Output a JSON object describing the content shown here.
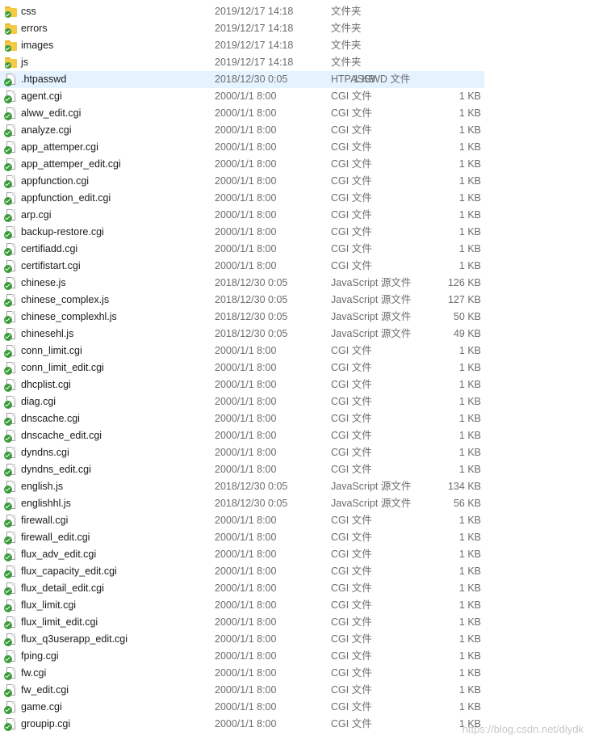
{
  "files": [
    {
      "name": "css",
      "date": "2019/12/17 14:18",
      "type": "文件夹",
      "size": "",
      "kind": "folder"
    },
    {
      "name": "errors",
      "date": "2019/12/17 14:18",
      "type": "文件夹",
      "size": "",
      "kind": "folder"
    },
    {
      "name": "images",
      "date": "2019/12/17 14:18",
      "type": "文件夹",
      "size": "",
      "kind": "folder"
    },
    {
      "name": "js",
      "date": "2019/12/17 14:18",
      "type": "文件夹",
      "size": "",
      "kind": "folder"
    },
    {
      "name": ".htpasswd",
      "date": "2018/12/30 0:05",
      "type": "HTPASSWD 文件",
      "size": "1 KB",
      "kind": "file",
      "selected": true
    },
    {
      "name": "agent.cgi",
      "date": "2000/1/1 8:00",
      "type": "CGI 文件",
      "size": "1 KB",
      "kind": "file"
    },
    {
      "name": "alww_edit.cgi",
      "date": "2000/1/1 8:00",
      "type": "CGI 文件",
      "size": "1 KB",
      "kind": "file"
    },
    {
      "name": "analyze.cgi",
      "date": "2000/1/1 8:00",
      "type": "CGI 文件",
      "size": "1 KB",
      "kind": "file"
    },
    {
      "name": "app_attemper.cgi",
      "date": "2000/1/1 8:00",
      "type": "CGI 文件",
      "size": "1 KB",
      "kind": "file"
    },
    {
      "name": "app_attemper_edit.cgi",
      "date": "2000/1/1 8:00",
      "type": "CGI 文件",
      "size": "1 KB",
      "kind": "file"
    },
    {
      "name": "appfunction.cgi",
      "date": "2000/1/1 8:00",
      "type": "CGI 文件",
      "size": "1 KB",
      "kind": "file"
    },
    {
      "name": "appfunction_edit.cgi",
      "date": "2000/1/1 8:00",
      "type": "CGI 文件",
      "size": "1 KB",
      "kind": "file"
    },
    {
      "name": "arp.cgi",
      "date": "2000/1/1 8:00",
      "type": "CGI 文件",
      "size": "1 KB",
      "kind": "file"
    },
    {
      "name": "backup-restore.cgi",
      "date": "2000/1/1 8:00",
      "type": "CGI 文件",
      "size": "1 KB",
      "kind": "file"
    },
    {
      "name": "certifiadd.cgi",
      "date": "2000/1/1 8:00",
      "type": "CGI 文件",
      "size": "1 KB",
      "kind": "file"
    },
    {
      "name": "certifistart.cgi",
      "date": "2000/1/1 8:00",
      "type": "CGI 文件",
      "size": "1 KB",
      "kind": "file"
    },
    {
      "name": "chinese.js",
      "date": "2018/12/30 0:05",
      "type": "JavaScript 源文件",
      "size": "126 KB",
      "kind": "file"
    },
    {
      "name": "chinese_complex.js",
      "date": "2018/12/30 0:05",
      "type": "JavaScript 源文件",
      "size": "127 KB",
      "kind": "file"
    },
    {
      "name": "chinese_complexhl.js",
      "date": "2018/12/30 0:05",
      "type": "JavaScript 源文件",
      "size": "50 KB",
      "kind": "file"
    },
    {
      "name": "chinesehl.js",
      "date": "2018/12/30 0:05",
      "type": "JavaScript 源文件",
      "size": "49 KB",
      "kind": "file"
    },
    {
      "name": "conn_limit.cgi",
      "date": "2000/1/1 8:00",
      "type": "CGI 文件",
      "size": "1 KB",
      "kind": "file"
    },
    {
      "name": "conn_limit_edit.cgi",
      "date": "2000/1/1 8:00",
      "type": "CGI 文件",
      "size": "1 KB",
      "kind": "file"
    },
    {
      "name": "dhcplist.cgi",
      "date": "2000/1/1 8:00",
      "type": "CGI 文件",
      "size": "1 KB",
      "kind": "file"
    },
    {
      "name": "diag.cgi",
      "date": "2000/1/1 8:00",
      "type": "CGI 文件",
      "size": "1 KB",
      "kind": "file"
    },
    {
      "name": "dnscache.cgi",
      "date": "2000/1/1 8:00",
      "type": "CGI 文件",
      "size": "1 KB",
      "kind": "file"
    },
    {
      "name": "dnscache_edit.cgi",
      "date": "2000/1/1 8:00",
      "type": "CGI 文件",
      "size": "1 KB",
      "kind": "file"
    },
    {
      "name": "dyndns.cgi",
      "date": "2000/1/1 8:00",
      "type": "CGI 文件",
      "size": "1 KB",
      "kind": "file"
    },
    {
      "name": "dyndns_edit.cgi",
      "date": "2000/1/1 8:00",
      "type": "CGI 文件",
      "size": "1 KB",
      "kind": "file"
    },
    {
      "name": "english.js",
      "date": "2018/12/30 0:05",
      "type": "JavaScript 源文件",
      "size": "134 KB",
      "kind": "file"
    },
    {
      "name": "englishhl.js",
      "date": "2018/12/30 0:05",
      "type": "JavaScript 源文件",
      "size": "56 KB",
      "kind": "file"
    },
    {
      "name": "firewall.cgi",
      "date": "2000/1/1 8:00",
      "type": "CGI 文件",
      "size": "1 KB",
      "kind": "file"
    },
    {
      "name": "firewall_edit.cgi",
      "date": "2000/1/1 8:00",
      "type": "CGI 文件",
      "size": "1 KB",
      "kind": "file"
    },
    {
      "name": "flux_adv_edit.cgi",
      "date": "2000/1/1 8:00",
      "type": "CGI 文件",
      "size": "1 KB",
      "kind": "file"
    },
    {
      "name": "flux_capacity_edit.cgi",
      "date": "2000/1/1 8:00",
      "type": "CGI 文件",
      "size": "1 KB",
      "kind": "file"
    },
    {
      "name": "flux_detail_edit.cgi",
      "date": "2000/1/1 8:00",
      "type": "CGI 文件",
      "size": "1 KB",
      "kind": "file"
    },
    {
      "name": "flux_limit.cgi",
      "date": "2000/1/1 8:00",
      "type": "CGI 文件",
      "size": "1 KB",
      "kind": "file"
    },
    {
      "name": "flux_limit_edit.cgi",
      "date": "2000/1/1 8:00",
      "type": "CGI 文件",
      "size": "1 KB",
      "kind": "file"
    },
    {
      "name": "flux_q3userapp_edit.cgi",
      "date": "2000/1/1 8:00",
      "type": "CGI 文件",
      "size": "1 KB",
      "kind": "file"
    },
    {
      "name": "fping.cgi",
      "date": "2000/1/1 8:00",
      "type": "CGI 文件",
      "size": "1 KB",
      "kind": "file"
    },
    {
      "name": "fw.cgi",
      "date": "2000/1/1 8:00",
      "type": "CGI 文件",
      "size": "1 KB",
      "kind": "file"
    },
    {
      "name": "fw_edit.cgi",
      "date": "2000/1/1 8:00",
      "type": "CGI 文件",
      "size": "1 KB",
      "kind": "file"
    },
    {
      "name": "game.cgi",
      "date": "2000/1/1 8:00",
      "type": "CGI 文件",
      "size": "1 KB",
      "kind": "file"
    },
    {
      "name": "groupip.cgi",
      "date": "2000/1/1 8:00",
      "type": "CGI 文件",
      "size": "1 KB",
      "kind": "file"
    }
  ],
  "watermark": "https://blog.csdn.net/dlydk",
  "colors": {
    "selected_row": "#e5f3ff",
    "folder": "#f5c944",
    "check": "#3a9b3a",
    "meta_text": "#6d6d6d"
  }
}
